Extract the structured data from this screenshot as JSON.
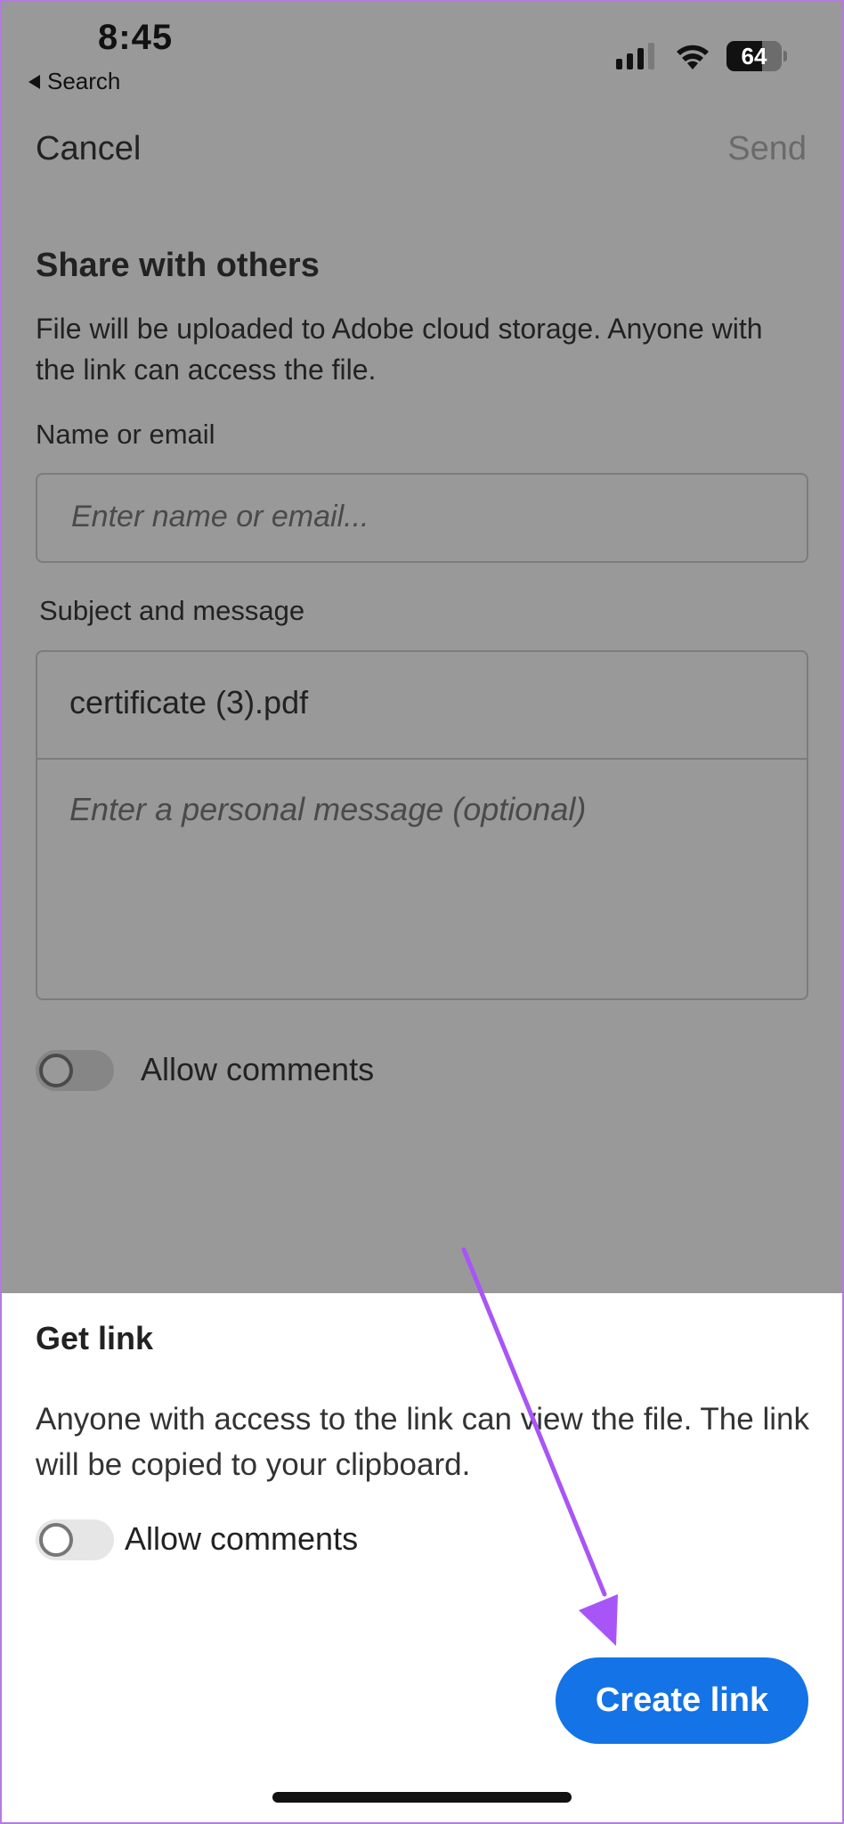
{
  "status": {
    "time": "8:45",
    "back_label": "Search",
    "battery": "64",
    "battery_level": 0.64
  },
  "nav": {
    "cancel_label": "Cancel",
    "send_label": "Send"
  },
  "share": {
    "title": "Share with others",
    "description": "File will be uploaded to Adobe cloud storage. Anyone with the link can access the file.",
    "name_label": "Name or email",
    "name_placeholder": "Enter name or email...",
    "subject_label": "Subject and message",
    "subject_value": "certificate (3).pdf",
    "message_placeholder": "Enter a personal message (optional)",
    "allow_comments_label": "Allow comments"
  },
  "sheet": {
    "title": "Get link",
    "description": "Anyone with access to the link can view the file. The link will be copied to your clipboard.",
    "allow_comments_label": "Allow comments",
    "create_link_label": "Create link"
  },
  "colors": {
    "accent": "#1473e6",
    "annotation_arrow": "#a855f7",
    "overlay": "#999999"
  },
  "icons": [
    "back-triangle-icon",
    "cellular-signal-icon",
    "wifi-icon",
    "battery-icon",
    "annotation-arrow"
  ]
}
